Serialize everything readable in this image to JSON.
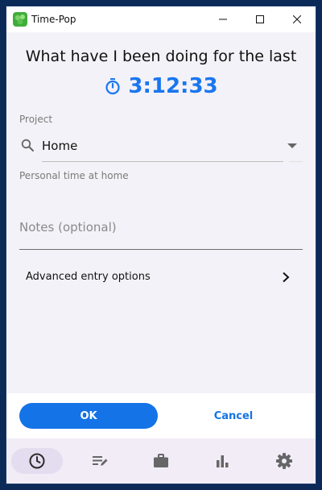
{
  "window": {
    "title": "Time-Pop"
  },
  "header": {
    "question": "What have I been doing for the last",
    "timer": "3:12:33"
  },
  "project": {
    "label": "Project",
    "value": "Home",
    "description": "Personal time at home"
  },
  "notes": {
    "placeholder": "Notes (optional)"
  },
  "advanced": {
    "label": "Advanced entry options"
  },
  "actions": {
    "ok_label": "OK",
    "cancel_label": "Cancel"
  },
  "nav": {
    "items": [
      {
        "icon": "timer-icon",
        "active": true
      },
      {
        "icon": "edit-list-icon",
        "active": false
      },
      {
        "icon": "briefcase-icon",
        "active": false
      },
      {
        "icon": "bar-chart-icon",
        "active": false
      },
      {
        "icon": "gear-icon",
        "active": false
      }
    ]
  },
  "colors": {
    "accent": "#1976f0",
    "button": "#1473e6",
    "content_bg": "#f3f2f8",
    "nav_bg": "#f1ecf6",
    "nav_active": "#e4ddf0"
  }
}
